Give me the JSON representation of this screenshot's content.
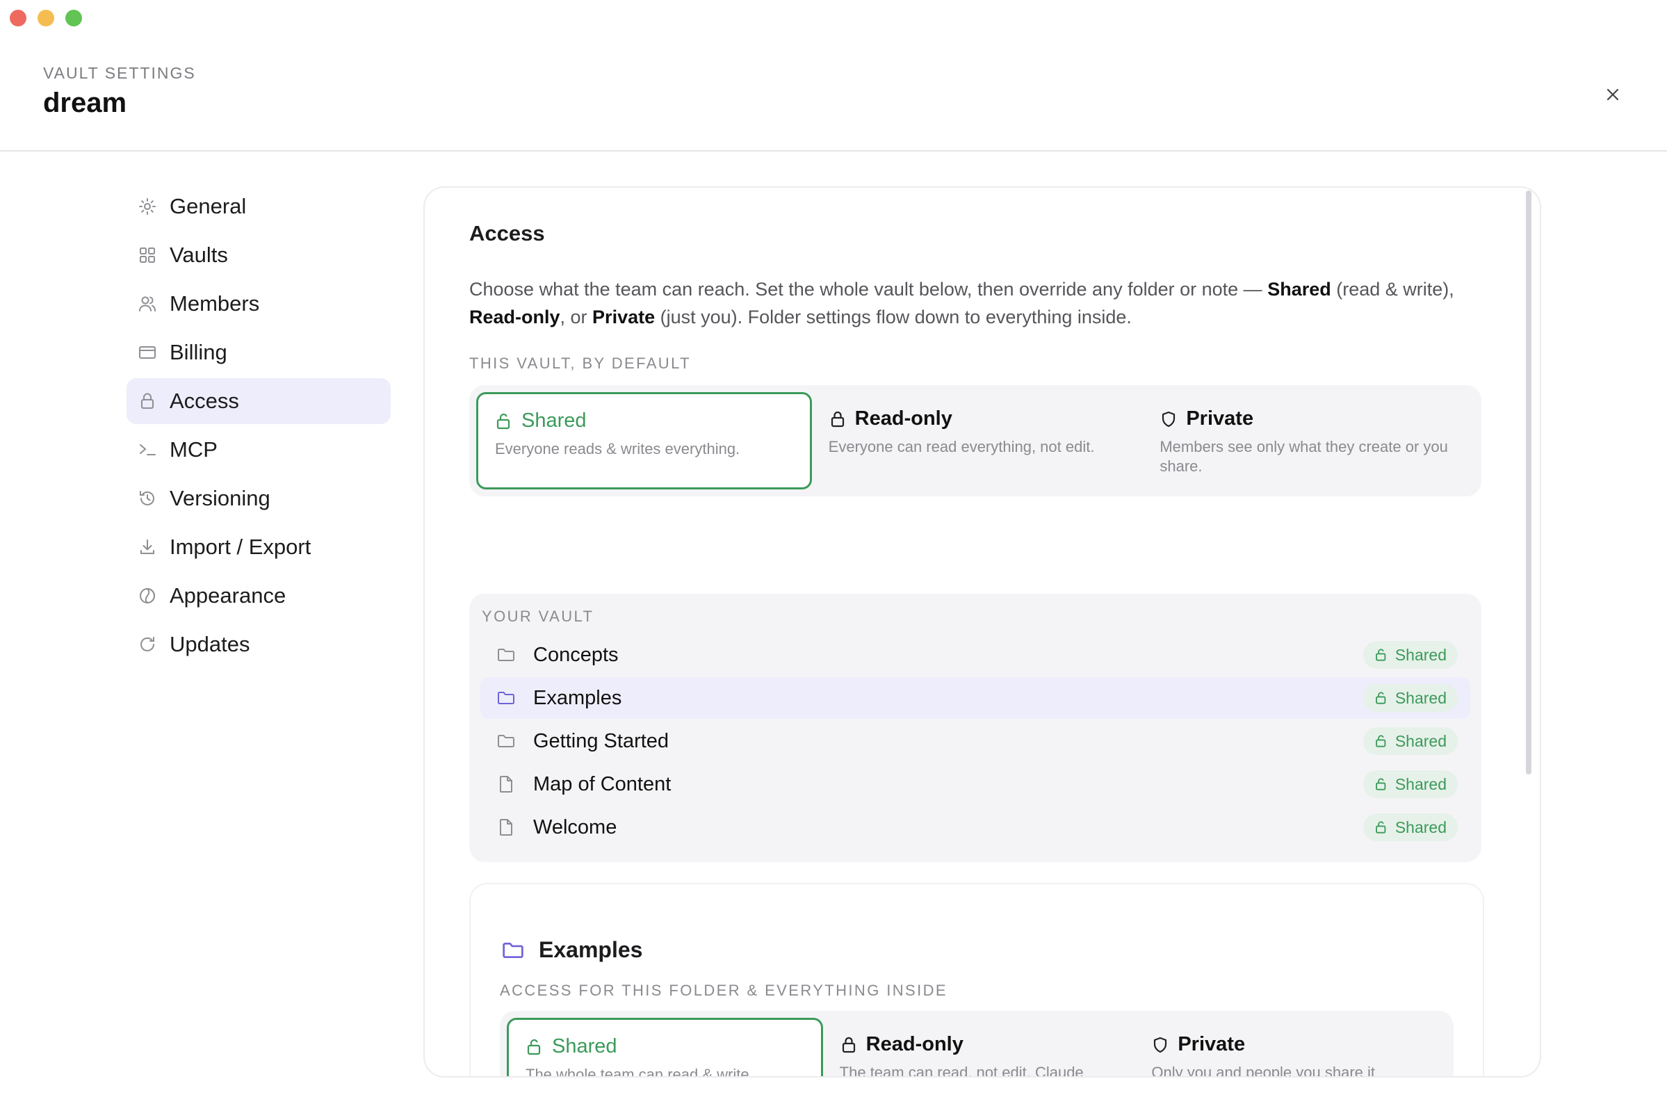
{
  "window": {
    "controls": [
      "close",
      "minimize",
      "zoom"
    ]
  },
  "header": {
    "eyebrow": "VAULT SETTINGS",
    "vault_name": "dream",
    "close_icon": "close-icon"
  },
  "sidebar": {
    "items": [
      {
        "label": "General",
        "icon": "gear-icon"
      },
      {
        "label": "Vaults",
        "icon": "grid-icon"
      },
      {
        "label": "Members",
        "icon": "users-icon"
      },
      {
        "label": "Billing",
        "icon": "credit-card-icon"
      },
      {
        "label": "Access",
        "icon": "lock-icon",
        "active": true
      },
      {
        "label": "MCP",
        "icon": "terminal-icon"
      },
      {
        "label": "Versioning",
        "icon": "history-icon"
      },
      {
        "label": "Import / Export",
        "icon": "download-icon"
      },
      {
        "label": "Appearance",
        "icon": "palette-icon"
      },
      {
        "label": "Updates",
        "icon": "refresh-icon"
      }
    ]
  },
  "access": {
    "title": "Access",
    "description": {
      "p1": "Choose what the team can reach. Set the whole vault below, then override any folder or note — ",
      "b1": "Shared",
      "p2": " (read & write), ",
      "b2": "Read-only",
      "p3": ", or ",
      "b3": "Private",
      "p4": " (just you). Folder settings flow down to everything inside."
    },
    "default_label": "THIS VAULT, BY DEFAULT",
    "default_options": [
      {
        "title": "Shared",
        "desc": "Everyone reads & writes everything.",
        "icon": "unlock-icon",
        "selected": true
      },
      {
        "title": "Read-only",
        "desc": "Everyone can read everything, not edit.",
        "icon": "lock-icon"
      },
      {
        "title": "Private",
        "desc": "Members see only what they create or you share.",
        "icon": "shield-icon"
      }
    ],
    "vault_label": "YOUR VAULT",
    "items": [
      {
        "name": "Concepts",
        "type": "folder",
        "badge": "Shared"
      },
      {
        "name": "Examples",
        "type": "folder",
        "badge": "Shared",
        "highlighted": true
      },
      {
        "name": "Getting Started",
        "type": "folder",
        "badge": "Shared"
      },
      {
        "name": "Map of Content",
        "type": "file",
        "badge": "Shared"
      },
      {
        "name": "Welcome",
        "type": "file",
        "badge": "Shared"
      }
    ],
    "folder_detail": {
      "name": "Examples",
      "label": "ACCESS FOR THIS FOLDER & EVERYTHING INSIDE",
      "options": [
        {
          "title": "Shared",
          "desc": "The whole team can read & write.",
          "icon": "unlock-icon",
          "selected": true
        },
        {
          "title": "Read-only",
          "desc": "The team can read, not edit. Claude",
          "icon": "lock-icon"
        },
        {
          "title": "Private",
          "desc": "Only you and people you share it",
          "icon": "shield-icon"
        }
      ]
    }
  },
  "colors": {
    "accent_green": "#3b9a5a",
    "accent_purple": "#6e62d8",
    "highlight": "#eeedfb",
    "panel": "#f4f4f6"
  }
}
